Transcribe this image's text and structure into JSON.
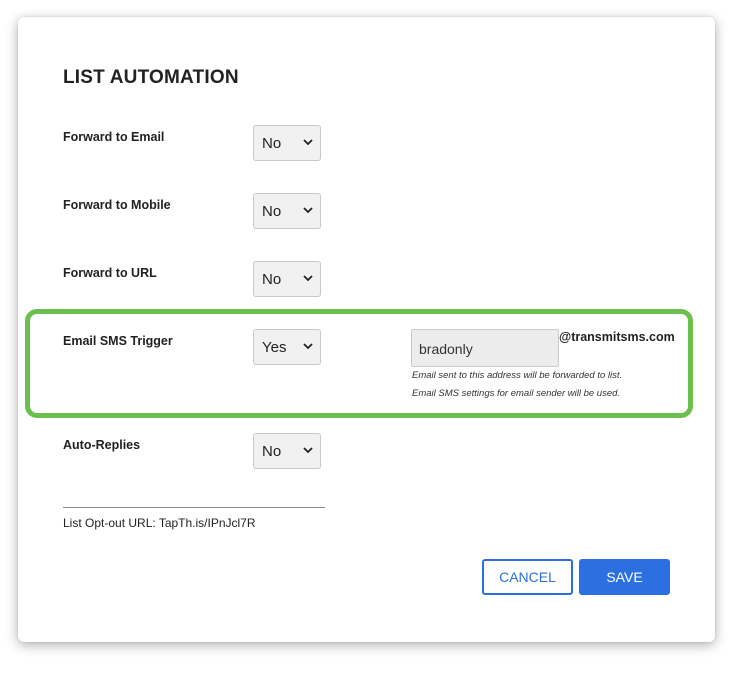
{
  "dialog": {
    "title": "LIST AUTOMATION"
  },
  "rows": [
    {
      "label": "Forward to Email",
      "value": "No"
    },
    {
      "label": "Forward to Mobile",
      "value": "No"
    },
    {
      "label": "Forward to URL",
      "value": "No"
    },
    {
      "label": "Email SMS Trigger",
      "value": "Yes"
    },
    {
      "label": "Auto-Replies",
      "value": "No"
    }
  ],
  "email_trigger": {
    "address_value": "bradonly",
    "domain_suffix": "@transmitsms.com",
    "help_line_1": "Email sent to this address will be forwarded to list.",
    "help_line_2": "Email SMS settings for email sender will be used.",
    "highlight_color": "#6bbf4e"
  },
  "opt_out": {
    "text": "List Opt-out URL: TapTh.is/IPnJcl7R"
  },
  "buttons": {
    "cancel_label": "CANCEL",
    "save_label": "SAVE",
    "accent_color": "#2b6fe0"
  },
  "icons": {
    "select_chevron": "chevron-down-icon"
  }
}
